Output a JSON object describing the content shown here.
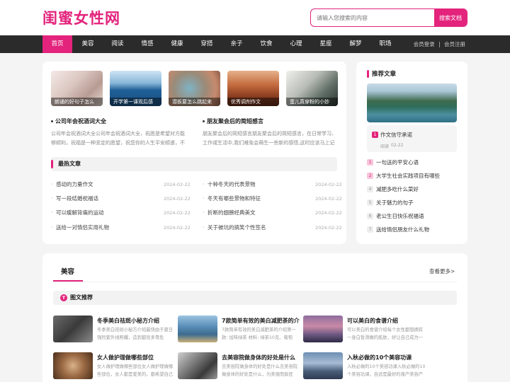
{
  "site": {
    "logo": "闺蜜女性网"
  },
  "search": {
    "placeholder": "请输入您搜索的内容",
    "button": "搜索文档"
  },
  "nav": {
    "items": [
      "首页",
      "美容",
      "阅读",
      "情感",
      "健康",
      "穿搭",
      "亲子",
      "饮食",
      "心理",
      "星座",
      "解梦",
      "职场"
    ],
    "login": "会员登录",
    "separator": "|",
    "register": "会员注册"
  },
  "featured_thumbs": [
    "朗诵的好句子怎么",
    "开学第一课观后感",
    "潜板要怎么跳起来",
    "优秀调剂作文",
    "蛋儿真穿粉的小妙"
  ],
  "lead_articles": [
    {
      "title": "公司年会祝酒词大全",
      "summary": "公司年会祝酒词大全公司年会祝酒词大全，祝愿是希望对方能够顺利，祝福是一种坚定的愿望，祝您你的人生平安顺遂，不"
    },
    {
      "title": "朋友聚会后的简短感言",
      "summary": "朋友聚会后的简短感言朋友聚会后的简短感言，在日常学习、工作或生活中,我们难免会萌生一些新的感悟,这时应该马上记"
    }
  ],
  "hot": {
    "title": "最热文章",
    "left": [
      {
        "title": "感动的力量作文",
        "date": "2024-02-22"
      },
      {
        "title": "写一段结婚祝福话",
        "date": "2024-02-22"
      },
      {
        "title": "可以缓解背痛的运动",
        "date": "2024-02-22"
      },
      {
        "title": "送给一对情侣实用礼物",
        "date": "2024-02-22"
      }
    ],
    "right": [
      {
        "title": "十种冬天的代表景物",
        "date": "2024-02-22"
      },
      {
        "title": "冬天有哪些景物和特征",
        "date": "2024-02-22"
      },
      {
        "title": "折断的翅膀经典美文",
        "date": "2024-02-22"
      },
      {
        "title": "关于被坑的搞笑个性签名",
        "date": "2024-02-22"
      }
    ]
  },
  "recommend": {
    "title": "推荐文章",
    "featured": {
      "num": "1",
      "title": "作文信守承诺",
      "meta": "阅读",
      "date": "02-22"
    },
    "list": [
      {
        "num": "1",
        "title": "一句送的平安心语"
      },
      {
        "num": "2",
        "title": "大学生社会实践项目有哪些"
      },
      {
        "num": "4",
        "title": "减肥多吃什么菜好"
      },
      {
        "num": "5",
        "title": "关于魅力的句子"
      },
      {
        "num": "6",
        "title": "老公生日快乐祝福语"
      },
      {
        "num": "7",
        "title": "送给情侣朋友什么礼物"
      }
    ]
  },
  "beauty": {
    "title": "美容",
    "more": "查看更多>",
    "sub_badge": "T",
    "sub_title": "图文推荐",
    "articles": [
      {
        "title": "冬季美白祛斑小秘方介绍",
        "desc": "冬季美白祛斑小秘方介绍最快由于夏日强烈紫外线照耀，造到都良多哥危"
      },
      {
        "title": "7款简单有效的美白减肥茶的介",
        "desc": "7款简单有效的美白减肥茶的介绍第一款: 加味绿茶 材料: 绿茶10克、葡萄"
      },
      {
        "title": "可以美白的食谱介绍",
        "desc": "可以美白的食谱介绍每个女性都想拥有一身白皙滑嫩的肌肤，好让自己成为一"
      },
      {
        "title": "女人做护理做哪些部位",
        "desc": "女人做护理做哪些部位女人做护理做哪些部位，女人都是爱美的，都希望自己"
      },
      {
        "title": "去美容院做身体的好处是什么",
        "desc": "去美容院做身体的好处是什么去美容院做身体的好处是什么，为美丽而疯狂"
      },
      {
        "title": "入秋必做的10个美容功课",
        "desc": "入秋必做的10个美容功课入秋必做的10个美容功课，自适是最好的葆产美容产"
      }
    ]
  }
}
